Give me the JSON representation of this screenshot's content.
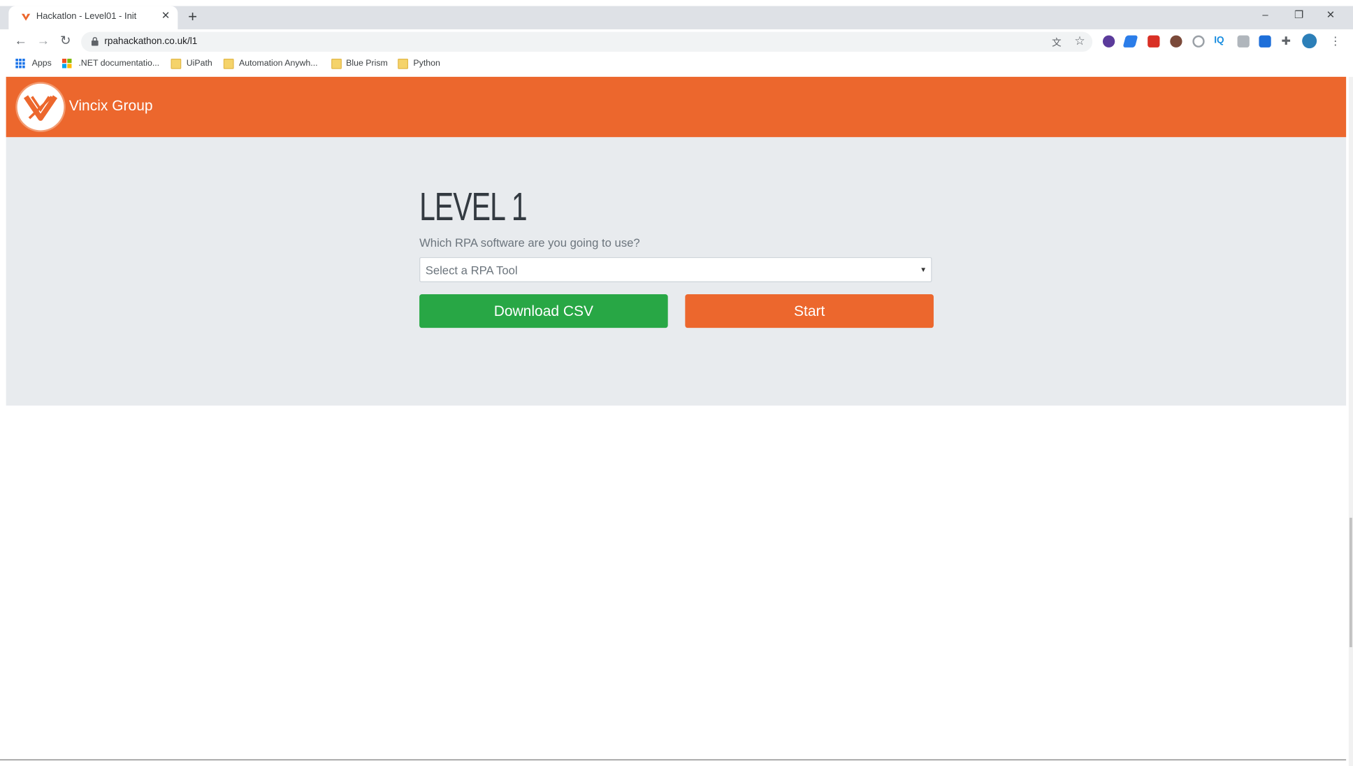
{
  "browser": {
    "tab_title": "Hackatlon - Level01 - Init",
    "url": "rpahackathon.co.uk/l1",
    "bookmarks": [
      {
        "label": "Apps"
      },
      {
        "label": ".NET documentatio..."
      },
      {
        "label": "UiPath"
      },
      {
        "label": "Automation Anywh..."
      },
      {
        "label": "Blue Prism"
      },
      {
        "label": "Python"
      }
    ],
    "window_controls": {
      "minimize": "–",
      "restore": "❐",
      "close": "✕"
    }
  },
  "header": {
    "brand_name": "Vincix Group"
  },
  "main": {
    "title": "LEVEL 1",
    "question": "Which RPA software are you going to use?",
    "select": {
      "placeholder": "Select a RPA Tool"
    },
    "download_label": "Download CSV",
    "start_label": "Start"
  },
  "colors": {
    "brand_orange": "#ec672d",
    "download_green": "#28a745",
    "hero_bg": "#e8ebee"
  }
}
